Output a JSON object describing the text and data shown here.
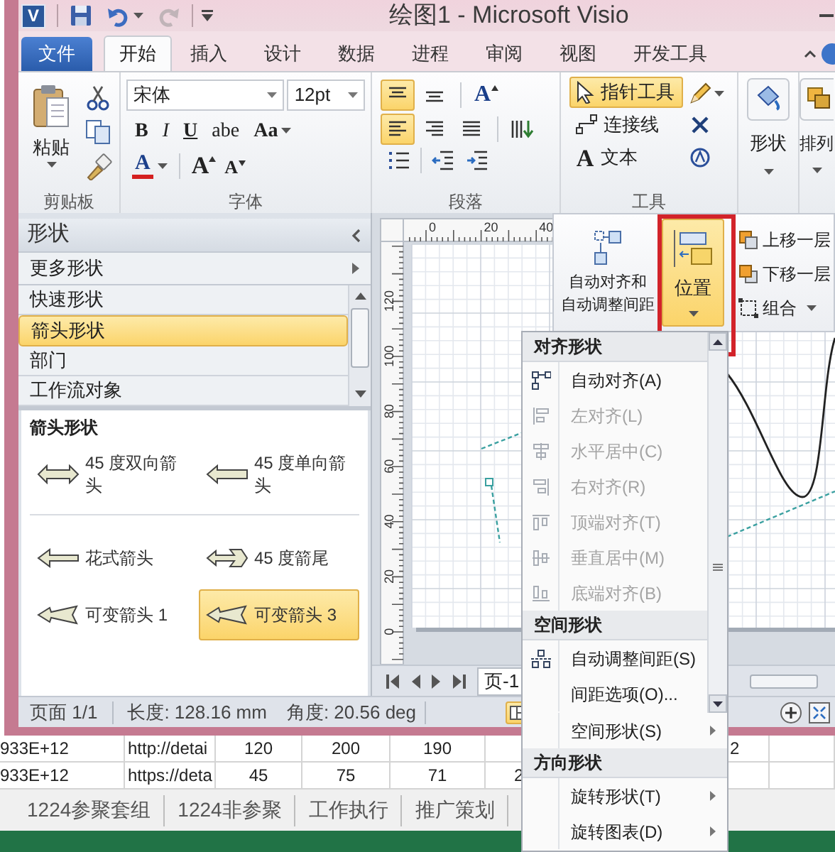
{
  "title_bar": {
    "app_letter": "V",
    "title": "绘图1 - Microsoft Visio"
  },
  "ribbon_tabs": [
    {
      "label": "文件",
      "kind": "backstage",
      "selected": false
    },
    {
      "label": "开始",
      "kind": "tab",
      "selected": true
    },
    {
      "label": "插入",
      "kind": "tab",
      "selected": false
    },
    {
      "label": "设计",
      "kind": "tab",
      "selected": false
    },
    {
      "label": "数据",
      "kind": "tab",
      "selected": false
    },
    {
      "label": "进程",
      "kind": "tab",
      "selected": false
    },
    {
      "label": "审阅",
      "kind": "tab",
      "selected": false
    },
    {
      "label": "视图",
      "kind": "tab",
      "selected": false
    },
    {
      "label": "开发工具",
      "kind": "tab",
      "selected": false
    }
  ],
  "ribbon": {
    "clipboard": {
      "paste_label": "粘贴",
      "group_label": "剪贴板"
    },
    "font": {
      "font_name": "宋体",
      "font_size": "12pt",
      "style_buttons": [
        {
          "kind": "bold",
          "label": "B"
        },
        {
          "kind": "italic",
          "label": "I"
        },
        {
          "kind": "underline",
          "label": "U"
        },
        {
          "kind": "strike",
          "label": "abe"
        },
        {
          "kind": "case",
          "label": "Aa"
        }
      ],
      "color_letter": "A",
      "grow_letter": "A",
      "shrink_letter": "A",
      "group_label": "字体"
    },
    "paragraph": {
      "align_buttons": [
        {
          "kind": "top",
          "selected": true
        },
        {
          "kind": "middle",
          "selected": false
        },
        {
          "kind": "left",
          "selected": true
        },
        {
          "kind": "right",
          "selected": false
        },
        {
          "kind": "justify",
          "selected": false
        }
      ],
      "text_letter": "A",
      "group_label": "段落"
    },
    "tools": {
      "items": [
        {
          "kind": "pointer",
          "label": "指针工具",
          "selected": true
        },
        {
          "kind": "connector",
          "label": "连接线",
          "selected": false
        },
        {
          "kind": "text",
          "icon_letter": "A",
          "label": "文本",
          "selected": false
        }
      ],
      "group_label": "工具"
    },
    "shapes_button": "形状",
    "arrange_button": "排列"
  },
  "arrange_panel": {
    "auto_align_lines": [
      "自动对齐和",
      "自动调整间距"
    ],
    "position": {
      "label": "位置",
      "selected": true
    },
    "bring_forward": "上移一层",
    "send_backward": "下移一层",
    "group": "组合"
  },
  "shapes_pane": {
    "title": "形状",
    "more_shapes": "更多形状",
    "stencils": [
      {
        "label": "快速形状",
        "selected": false
      },
      {
        "label": "箭头形状",
        "selected": true
      },
      {
        "label": "部门",
        "selected": false
      },
      {
        "label": "工作流对象",
        "selected": false
      }
    ],
    "section_title": "箭头形状",
    "masters": [
      {
        "kind": "double-arrow",
        "label": "45 度双向箭头",
        "selected": false
      },
      {
        "kind": "single-arrow",
        "label": "45 度单向箭头",
        "selected": false
      },
      {
        "kind": "fancy-arrow",
        "label": "花式箭头",
        "selected": false
      },
      {
        "kind": "tail-arrow",
        "label": "45 度箭尾",
        "selected": false
      },
      {
        "kind": "variable-arrow",
        "label": "可变箭头 1",
        "selected": false
      },
      {
        "kind": "variable-arrow",
        "label": "可变箭头 3",
        "selected": true
      }
    ]
  },
  "drawing": {
    "top_ruler": [
      "0",
      "20",
      "40"
    ],
    "left_ruler": [
      "120",
      "100",
      "80",
      "60",
      "40",
      "20",
      "0"
    ],
    "page_tab": "页-1"
  },
  "status_bar": {
    "page": "页面 1/1",
    "length": "长度: 128.16 mm",
    "angle": "角度: 20.56 deg"
  },
  "position_menu": {
    "gallery": [
      {
        "kind": "header",
        "label": "对齐形状"
      },
      {
        "kind": "item",
        "label": "自动对齐(A)",
        "disabled": false
      },
      {
        "kind": "item",
        "label": "左对齐(L)",
        "disabled": true
      },
      {
        "kind": "item",
        "label": "水平居中(C)",
        "disabled": true
      },
      {
        "kind": "item",
        "label": "右对齐(R)",
        "disabled": true
      },
      {
        "kind": "item",
        "label": "顶端对齐(T)",
        "disabled": true
      },
      {
        "kind": "item",
        "label": "垂直居中(M)",
        "disabled": true
      },
      {
        "kind": "item",
        "label": "底端对齐(B)",
        "disabled": true
      },
      {
        "kind": "header",
        "label": "空间形状"
      },
      {
        "kind": "item",
        "label": "自动调整间距(S)",
        "disabled": false
      },
      {
        "kind": "item",
        "label": "间距选项(O)...",
        "disabled": false
      }
    ],
    "more": [
      {
        "kind": "item",
        "label": "空间形状(S)",
        "submenu": true
      },
      {
        "kind": "header",
        "label": "方向形状"
      },
      {
        "kind": "item",
        "label": "旋转形状(T)",
        "submenu": true
      },
      {
        "kind": "item",
        "label": "旋转图表(D)",
        "submenu": true
      }
    ]
  },
  "spreadsheet": {
    "rows": [
      {
        "cells": [
          "933E+12",
          "http://detai",
          "120",
          "200",
          "190"
        ],
        "column_7": "2"
      },
      {
        "cells": [
          "933E+12",
          "https://deta",
          "45",
          "75",
          "71",
          "2"
        ]
      }
    ],
    "sheet_tabs": [
      "1224参聚套组",
      "1224非参聚",
      "工作执行",
      "推广策划"
    ]
  }
}
